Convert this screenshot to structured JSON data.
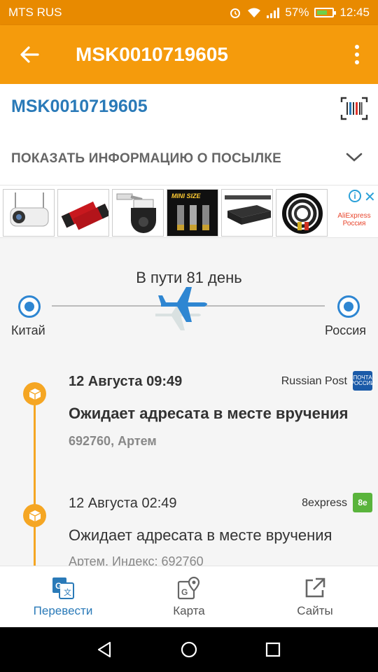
{
  "status_bar": {
    "carrier": "MTS RUS",
    "battery_percent": "57%",
    "time": "12:45",
    "icons": [
      "alarm-icon",
      "wifi-icon",
      "signal-icon",
      "battery-icon"
    ]
  },
  "app_bar": {
    "title": "MSK0010719605",
    "back_icon": "arrow-left-icon",
    "menu_icon": "more-vert-icon"
  },
  "parcel": {
    "tracking_number": "MSK0010719605",
    "show_info_label": "ПОКАЗАТЬ ИНФОРМАЦИЮ О ПОСЫЛКЕ"
  },
  "ads": {
    "banner_logo": "AliExpress Россия",
    "mini_size_text": "MINI SIZE"
  },
  "route": {
    "status": "В пути 81 день",
    "from": "Китай",
    "to": "Россия"
  },
  "events": [
    {
      "date": "12 Августа 09:49",
      "carrier": "Russian Post",
      "carrier_logo": "ПОЧТА РОССИИ",
      "status": "Ожидает адресата в месте вручения",
      "place": "692760, Артем"
    },
    {
      "date": "12 Августа 02:49",
      "carrier": "8express",
      "carrier_logo": "8e",
      "status": "Ожидает адресата в месте вручения",
      "place": "Артем, Индекс: 692760"
    }
  ],
  "bottom_nav": [
    {
      "label": "Перевести",
      "icon": "translate-icon",
      "active": true
    },
    {
      "label": "Карта",
      "icon": "map-icon",
      "active": false
    },
    {
      "label": "Сайты",
      "icon": "open-external-icon",
      "active": false
    }
  ],
  "colors": {
    "status_bar": "#e88a00",
    "app_bar": "#f59b0c",
    "accent_blue": "#2a7ab8",
    "timeline_orange": "#f5a623"
  }
}
